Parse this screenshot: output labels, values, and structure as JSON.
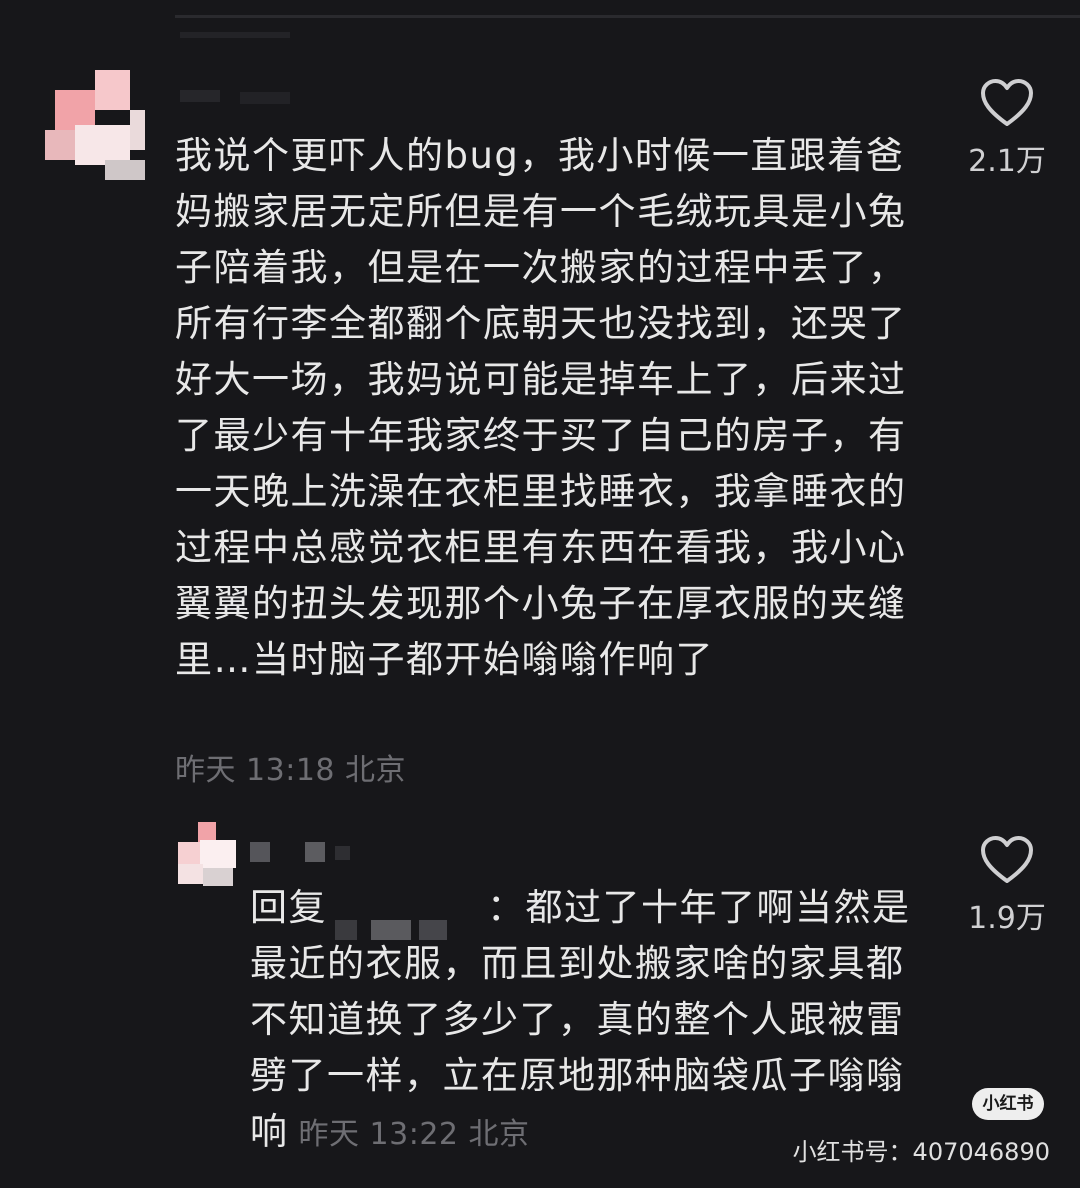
{
  "comment": {
    "text": "我说个更吓人的bug，我小时候一直跟着爸妈搬家居无定所但是有一个毛绒玩具是小兔子陪着我，但是在一次搬家的过程中丢了，所有行李全都翻个底朝天也没找到，还哭了好大一场，我妈说可能是掉车上了，后来过了最少有十年我家终于买了自己的房子，有一天晚上洗澡在衣柜里找睡衣，我拿睡衣的过程中总感觉衣柜里有东西在看我，我小心翼翼的扭头发现那个小兔子在厚衣服的夹缝里…当时脑子都开始嗡嗡作响了",
    "meta": "昨天 13:18 北京",
    "likes": "2.1万",
    "like_icon": "heart-outline-icon"
  },
  "reply": {
    "prefix": "回复",
    "separator": "：",
    "text": "都过了十年了啊当然是最近的衣服，而且到处搬家啥的家具都不知道换了多少了，真的整个人跟被雷劈了一样，立在原地那种脑袋瓜子嗡嗡响",
    "meta": "昨天 13:22 北京",
    "likes": "1.9万",
    "like_icon": "heart-outline-icon"
  },
  "watermark": {
    "badge": "小红书",
    "id_text": "小红书号：407046890"
  },
  "colors": {
    "background": "#17171a",
    "text": "#e8e8e8",
    "meta": "#6e6e73"
  }
}
